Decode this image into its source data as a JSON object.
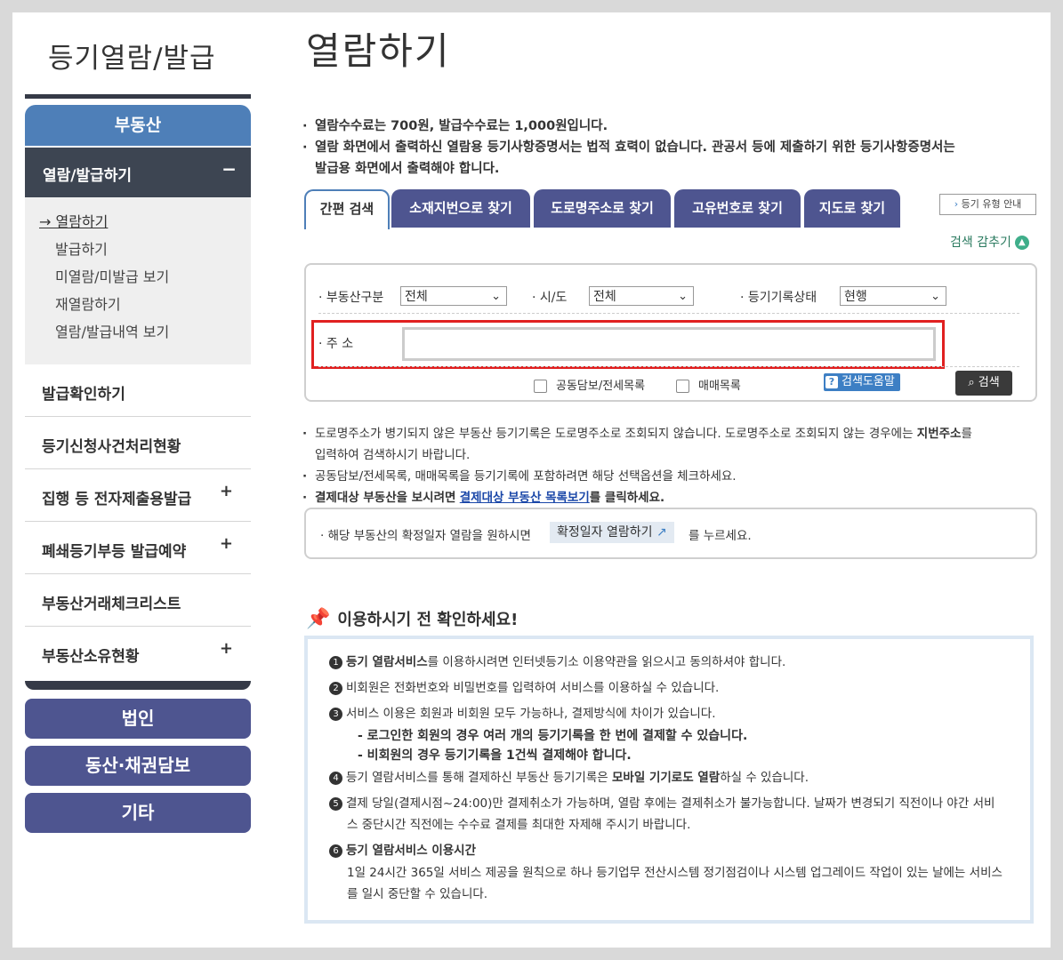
{
  "sidebar": {
    "title": "등기열람/발급",
    "main_label": "부동산",
    "section_label": "열람/발급하기",
    "section_toggle": "−",
    "sub_items": [
      {
        "label": "→ 열람하기"
      },
      {
        "label": "발급하기"
      },
      {
        "label": "미열람/미발급 보기"
      },
      {
        "label": "재열람하기"
      },
      {
        "label": "열람/발급내역 보기"
      }
    ],
    "menus": [
      {
        "label": "발급확인하기",
        "toggle": ""
      },
      {
        "label": "등기신청사건처리현황",
        "toggle": ""
      },
      {
        "label": "집행 등 전자제출용발급",
        "toggle": "+"
      },
      {
        "label": "폐쇄등기부등 발급예약",
        "toggle": "+"
      },
      {
        "label": "부동산거래체크리스트",
        "toggle": ""
      },
      {
        "label": "부동산소유현황",
        "toggle": "+"
      }
    ],
    "buttons": [
      "법인",
      "동산·채권담보",
      "기타"
    ]
  },
  "main": {
    "title": "열람하기",
    "notes_top": [
      "열람수수료는 700원, 발급수수료는 1,000원입니다.",
      "열람 화면에서 출력하신 열람용 등기사항증명서는 법적 효력이 없습니다. 관공서 등에 제출하기 위한 등기사항증명서는",
      "발급용 화면에서 출력해야 합니다."
    ],
    "tabs": [
      "간편 검색",
      "소재지번으로 찾기",
      "도로명주소로 찾기",
      "고유번호로 찾기",
      "지도로 찾기"
    ],
    "guide_button": "등기 유형 안내",
    "collapse_label": "검색 감추기",
    "collapse_icon": "chevron-up-icon",
    "search": {
      "property_type_label": "부동산구분",
      "property_type_value": "전체",
      "region_label": "시/도",
      "region_value": "전체",
      "status_label": "등기기록상태",
      "status_value": "현행",
      "address_label": "주 소",
      "address_value": "",
      "check_joint": "공동담보/전세목록",
      "check_sale": "매매목록",
      "help_label": "검색도움말",
      "help_icon": "question-icon",
      "search_button": "검색",
      "search_icon": "magnifier-icon",
      "highlight_color": "#e02020"
    },
    "notes_mid": {
      "line1a": "도로명주소가 병기되지 않은 부동산 등기기록은 도로명주소로 조회되지 않습니다. 도로명주소로 조회되지 않는 경우에는",
      "line1b": "지번주소",
      "line1c": "를",
      "line1d": "입력하여 검색하시기 바랍니다.",
      "line2": "공동담보/전세목록, 매매목록을 등기기록에 포함하려면 해당 선택옵션을 체크하세요.",
      "line3a": "결제대상 부동산을 보시려면",
      "line3link": "결제대상 부동산 목록보기",
      "line3b": "를 클릭하세요."
    },
    "confirm": {
      "text": "해당 부동산의 확정일자 열람을 원하시면",
      "button": "확정일자 열람하기",
      "button_icon": "external-link-icon",
      "tail": "를 누르세요."
    },
    "check_title": "이용하시기 전 확인하세요!",
    "check_icon": "pin-icon",
    "info": {
      "l1_num": "1",
      "l1_bold": "등기 열람서비스",
      "l1_rest": "를 이용하시려면 인터넷등기소 이용약관을 읽으시고 동의하셔야 합니다.",
      "l2_num": "2",
      "l2": "비회원은 전화번호와 비밀번호를 입력하여 서비스를 이용하실 수 있습니다.",
      "l3_num": "3",
      "l3": "서비스 이용은 회원과 비회원 모두 가능하나, 결제방식에 차이가 있습니다.",
      "l3a": "- 로그인한 회원의 경우 여러 개의 등기기록을 한 번에 결제할 수 있습니다.",
      "l3b": "- 비회원의 경우 등기기록을 1건씩 결제해야 합니다.",
      "l4_num": "4",
      "l4a": "등기 열람서비스를 통해 결제하신 부동산 등기기록은",
      "l4_bold": "모바일 기기로도 열람",
      "l4b": "하실 수 있습니다.",
      "l5_num": "5",
      "l5a": "결제 당일(결제시점~24:00)만 결제취소가 가능하며, 열람 후에는 결제취소가 불가능합니다. 날짜가 변경되기 직전이나 야간 서비",
      "l5b": "스 중단시간 직전에는 수수료 결제를 최대한 자제해 주시기 바랍니다.",
      "l6_num": "6",
      "l6_bold": "등기 열람서비스 이용시간",
      "l6a": "1일 24시간 365일 서비스 제공을 원칙으로 하나 등기업무 전산시스템 정기점검이나 시스템 업그레이드 작업이 있는 날에는 서비스",
      "l6b": "를 일시 중단할 수 있습니다."
    }
  }
}
